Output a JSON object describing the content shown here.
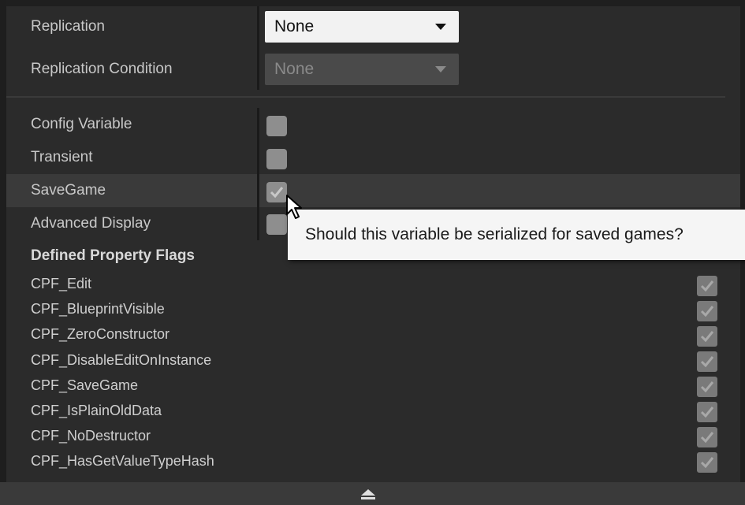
{
  "replication": {
    "label": "Replication",
    "value": "None"
  },
  "replication_condition": {
    "label": "Replication Condition",
    "value": "None"
  },
  "options": [
    {
      "label": "Config Variable",
      "checked": false
    },
    {
      "label": "Transient",
      "checked": false
    },
    {
      "label": "SaveGame",
      "checked": true
    },
    {
      "label": "Advanced Display",
      "checked": false
    }
  ],
  "defined_flags": {
    "heading": "Defined Property Flags",
    "items": [
      {
        "label": "CPF_Edit",
        "checked": true
      },
      {
        "label": "CPF_BlueprintVisible",
        "checked": true
      },
      {
        "label": "CPF_ZeroConstructor",
        "checked": true
      },
      {
        "label": "CPF_DisableEditOnInstance",
        "checked": true
      },
      {
        "label": "CPF_SaveGame",
        "checked": true
      },
      {
        "label": "CPF_IsPlainOldData",
        "checked": true
      },
      {
        "label": "CPF_NoDestructor",
        "checked": true
      },
      {
        "label": "CPF_HasGetValueTypeHash",
        "checked": true
      }
    ]
  },
  "tooltip": {
    "text": "Should this variable be serialized for saved games?"
  },
  "footer": {
    "icon": "collapse-up-arrow-icon"
  },
  "colors": {
    "panel_bg": "#2b2b2b",
    "highlight_row": "#3a3a3a",
    "tooltip_bg": "#f5f5f5"
  }
}
